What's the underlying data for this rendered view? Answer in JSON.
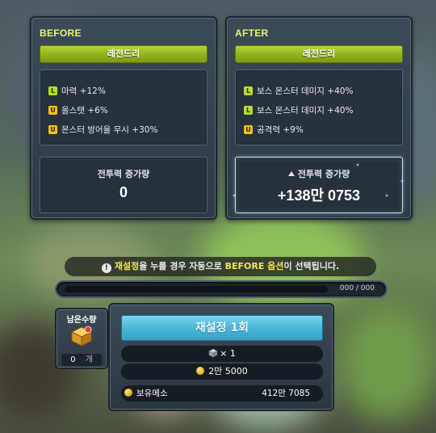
{
  "before": {
    "title": "BEFORE",
    "grade": "레전드리",
    "options": [
      {
        "grade": "L",
        "text": "마력 +12%"
      },
      {
        "grade": "U",
        "text": "올스탯 +6%"
      },
      {
        "grade": "U",
        "text": "몬스터 방어율 무시 +30%"
      }
    ],
    "cp_label": "전투력 증가량",
    "cp_value": "0"
  },
  "after": {
    "title": "AFTER",
    "grade": "레전드리",
    "options": [
      {
        "grade": "L",
        "text": "보스 몬스터 데미지 +40%"
      },
      {
        "grade": "L",
        "text": "보스 몬스터 데미지 +40%"
      },
      {
        "grade": "U",
        "text": "공격력 +9%"
      }
    ],
    "cp_label": "전투력 증가량",
    "cp_value": "+138만 0753"
  },
  "notice": {
    "part1": "재설정",
    "part2": "을 누를 경우 자동으로 ",
    "part3": "BEFORE 옵션",
    "part4": "이 선택됩니다."
  },
  "progress": {
    "label": "000 / 000",
    "fill_fraction": 0
  },
  "remain": {
    "label": "남은수량",
    "count": "0",
    "unit": "개"
  },
  "action": {
    "reset_label": "재설정 1회",
    "cube_cost": "× 1",
    "meso_cost": "2만 5000",
    "owned_label": "보유메소",
    "owned_value": "412만 7085"
  },
  "colors": {
    "title_yellow": "#e9f37a",
    "grade_green": "#9cc020",
    "legendary_badge": "#b7dd2e",
    "unique_badge": "#f0c21c",
    "reset_blue": "#46b3d8"
  }
}
